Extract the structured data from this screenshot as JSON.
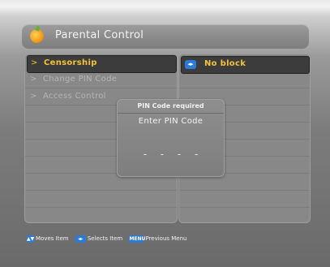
{
  "title": "Parental Control",
  "menu": [
    {
      "label": "Censorship",
      "selected": true
    },
    {
      "label": "Change PIN Code",
      "selected": false
    },
    {
      "label": "Access Control",
      "selected": false
    }
  ],
  "menu_arrow": ">",
  "value": {
    "text": "No block",
    "icon": "left-right-arrows-icon",
    "icon_glyph": "◂▸"
  },
  "dialog": {
    "header": "PIN Code required",
    "prompt": "Enter PIN Code",
    "digits": [
      "-",
      "-",
      "-",
      "-"
    ]
  },
  "footer": {
    "moves_icon_glyph": "▲▼",
    "moves_text": "Moves Item",
    "selects_icon_glyph": "◂▸",
    "selects_text": "Selects Item",
    "menu_key": "MENU",
    "menu_text": "Previous Menu"
  },
  "colors": {
    "highlight_text": "#f6c33a",
    "button_blue": "#2a7cd8",
    "panel_gray": "#888888"
  }
}
